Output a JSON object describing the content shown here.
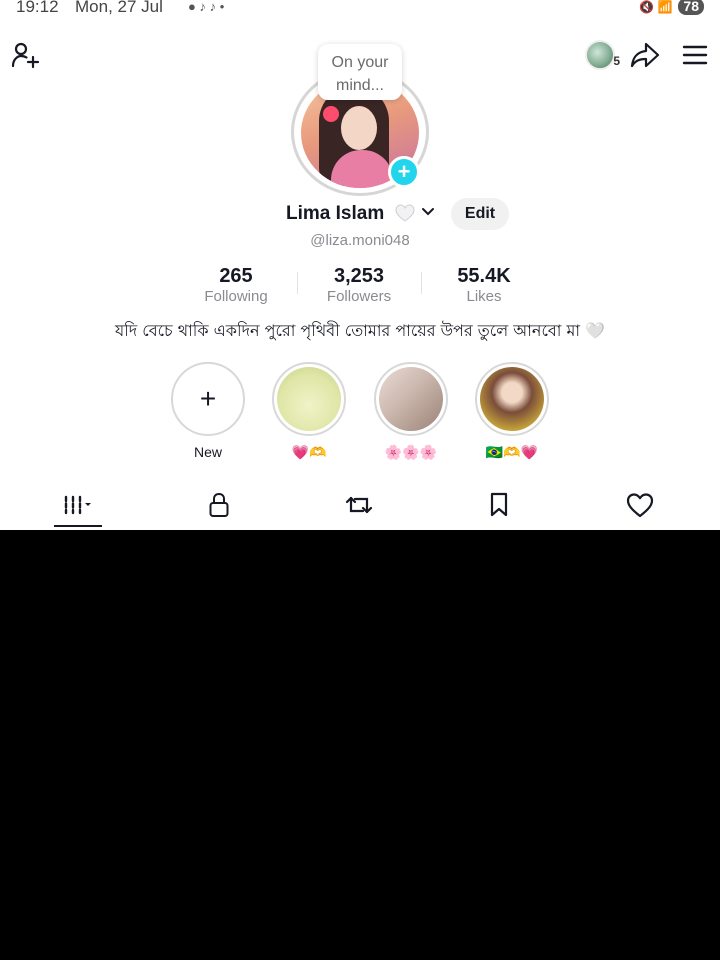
{
  "status_bar": {
    "time": "19:12",
    "date": "Mon, 27 Jul",
    "notification_icons": "● ♪ ♪ •",
    "signal_icons": "🔇 📶",
    "battery": "78"
  },
  "header": {
    "story_count": "5"
  },
  "profile": {
    "bubble_text": "On your mind...",
    "name": "Lima Islam",
    "edit_label": "Edit",
    "username": "@liza.moni048"
  },
  "stats": [
    {
      "value": "265",
      "label": "Following"
    },
    {
      "value": "3,253",
      "label": "Followers"
    },
    {
      "value": "55.4K",
      "label": "Likes"
    }
  ],
  "bio": "যদি বেচে থাকি একদিন পুরো পৃথিবী তোমার পায়ের উপর তুলে আনবো মা 🤍",
  "highlights": [
    {
      "label": "New"
    },
    {
      "label": "💗🫶"
    },
    {
      "label": "🌸🌸🌸"
    },
    {
      "label": "🇧🇷🫶💗"
    }
  ],
  "colors": {
    "accent": "#20d5ec",
    "text": "#161823",
    "muted": "#8a8b91"
  },
  "icons": [
    "add-user-icon",
    "share-icon",
    "menu-icon",
    "grid-icon",
    "lock-icon",
    "repost-icon",
    "bookmark-icon",
    "heart-icon"
  ]
}
